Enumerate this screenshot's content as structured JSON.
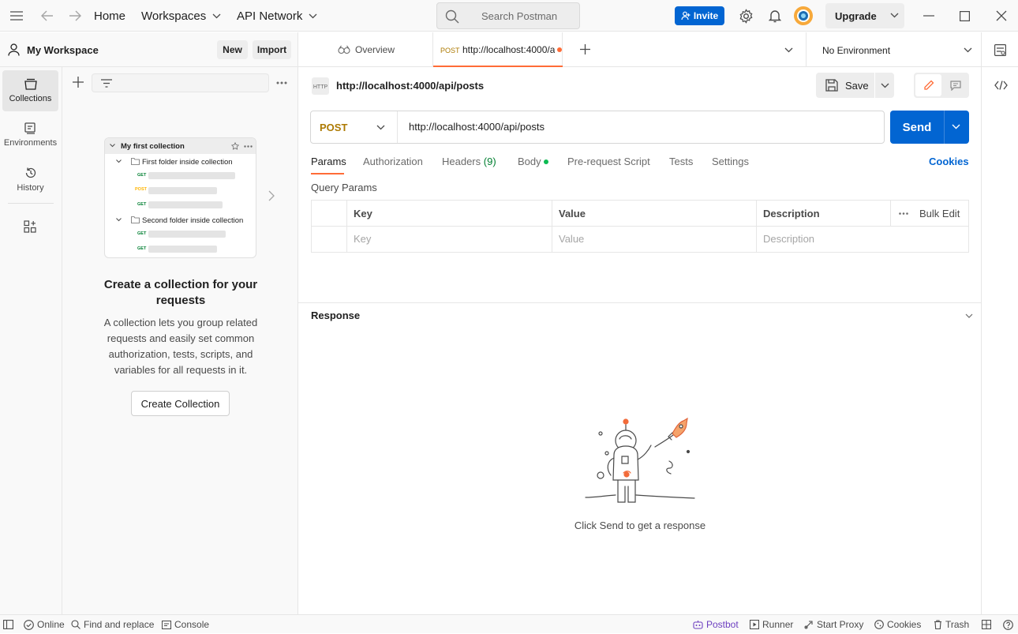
{
  "topbar": {
    "home": "Home",
    "workspaces": "Workspaces",
    "api_network": "API Network",
    "search_placeholder": "Search Postman",
    "invite": "Invite",
    "upgrade": "Upgrade"
  },
  "workspace": {
    "name": "My Workspace",
    "new_label": "New",
    "import_label": "Import"
  },
  "rail": {
    "items": [
      {
        "label": "Collections",
        "icon": "collections-icon",
        "active": true
      },
      {
        "label": "Environments",
        "icon": "environments-icon",
        "active": false
      },
      {
        "label": "History",
        "icon": "history-icon",
        "active": false
      }
    ]
  },
  "preview": {
    "collection": "My first collection",
    "folder1": "First folder inside collection",
    "folder2": "Second folder inside collection",
    "methods": [
      "GET",
      "POST",
      "GET",
      "GET",
      "GET"
    ]
  },
  "empty_state": {
    "title": "Create a collection for your requests",
    "description": "A collection lets you group related requests and easily set common authorization, tests, scripts, and variables for all requests in it.",
    "button": "Create Collection"
  },
  "tabs": {
    "overview": "Overview",
    "active_method": "POST",
    "active_url": "http://localhost:4000/a",
    "environment": "No Environment"
  },
  "request": {
    "title": "http://localhost:4000/api/posts",
    "save": "Save",
    "method": "POST",
    "url": "http://localhost:4000/api/posts",
    "send": "Send"
  },
  "subtabs": {
    "params": "Params",
    "authorization": "Authorization",
    "headers": "Headers",
    "headers_count": "(9)",
    "body": "Body",
    "prerequest": "Pre-request Script",
    "tests": "Tests",
    "settings": "Settings",
    "cookies": "Cookies"
  },
  "params": {
    "title": "Query Params",
    "columns": [
      "Key",
      "Value",
      "Description"
    ],
    "bulk_edit": "Bulk Edit",
    "placeholders": [
      "Key",
      "Value",
      "Description"
    ]
  },
  "response": {
    "title": "Response",
    "hint": "Click Send to get a response"
  },
  "statusbar": {
    "online": "Online",
    "find_replace": "Find and replace",
    "console": "Console",
    "postbot": "Postbot",
    "runner": "Runner",
    "start_proxy": "Start Proxy",
    "cookies": "Cookies",
    "trash": "Trash"
  },
  "colors": {
    "accent": "#0265d2",
    "post_method": "#ad7a03",
    "get_method": "#007f31",
    "tab_indicator": "#ff6c37",
    "body_dot": "#0cbb52"
  }
}
